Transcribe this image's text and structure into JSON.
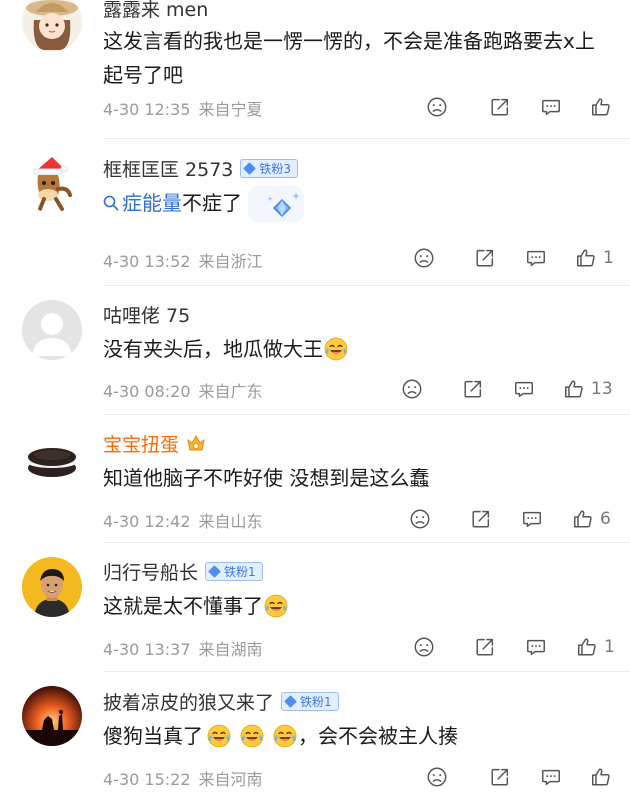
{
  "comments": [
    {
      "username": "露露来 men",
      "text": "这发言看的我也是一愣一愣的，不会是准备跑路要去x上起号了吧",
      "date": "4-30 12:35",
      "location": "来自宁夏",
      "likes": ""
    },
    {
      "username": "框框匡匡 2573",
      "fan_badge": "铁粉3",
      "topic": "症能量",
      "text_after": "不症了",
      "date": "4-30 13:52",
      "location": "来自浙江",
      "likes": "1"
    },
    {
      "username": "咕哩佬 75",
      "text": "没有夹头后，地瓜做大王",
      "date": "4-30 08:20",
      "location": "来自广东",
      "likes": "13"
    },
    {
      "username": "宝宝扭蛋",
      "text": "知道他脑子不咋好使 没想到是这么蠢",
      "date": "4-30 12:42",
      "location": "来自山东",
      "likes": "6"
    },
    {
      "username": "归行号船长",
      "fan_badge": "铁粉1",
      "text": "这就是太不懂事了",
      "date": "4-30 13:37",
      "location": "来自湖南",
      "likes": "1"
    },
    {
      "username": "披着凉皮的狼又来了",
      "fan_badge": "铁粉1",
      "text_before": "傻狗当真了",
      "text_after": "，会不会被主人揍",
      "date": "4-30 15:22",
      "location": "来自河南",
      "likes": ""
    }
  ],
  "icons": {
    "dislike": "frown-face-icon",
    "share": "share-icon",
    "comment": "comment-icon",
    "like": "thumbs-up-icon",
    "laugh_emoji": "laughing-tears-emoji"
  },
  "colors": {
    "link": "#2f6fd8",
    "vip_name": "#ff6a00",
    "fan_badge": "#3a78e8",
    "meta": "#9a9a9a"
  }
}
